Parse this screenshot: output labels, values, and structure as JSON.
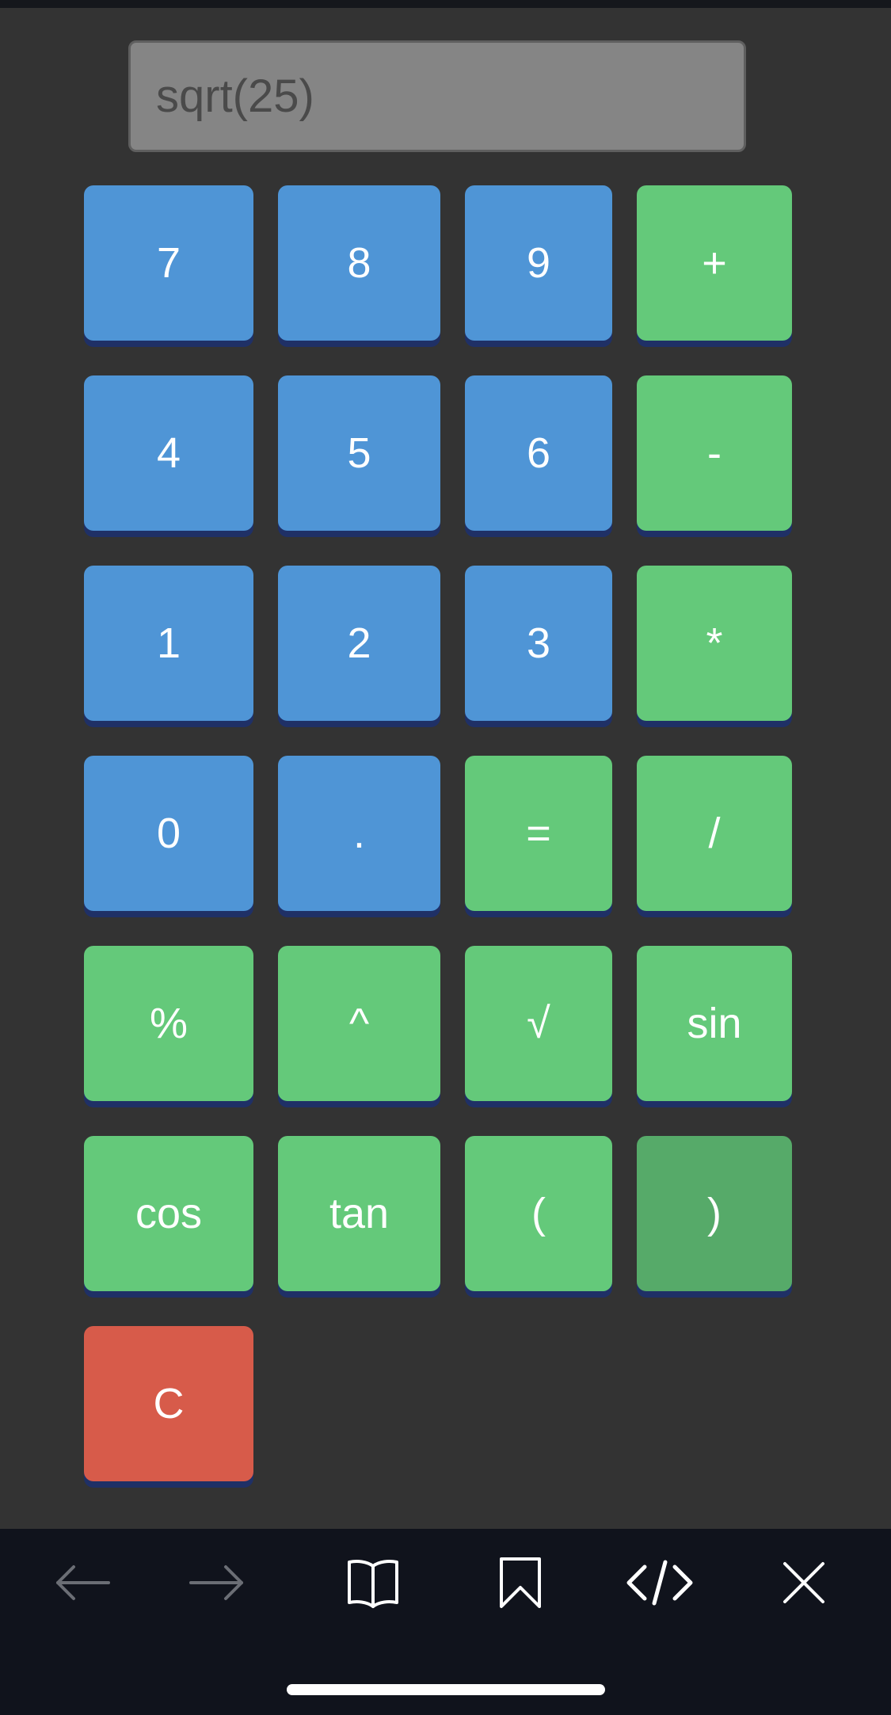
{
  "display": {
    "expression": "sqrt(25)"
  },
  "keypad": {
    "keys": [
      {
        "label": "7",
        "kind": "num"
      },
      {
        "label": "8",
        "kind": "num"
      },
      {
        "label": "9",
        "kind": "num"
      },
      {
        "label": "+",
        "kind": "op"
      },
      {
        "label": "4",
        "kind": "num"
      },
      {
        "label": "5",
        "kind": "num"
      },
      {
        "label": "6",
        "kind": "num"
      },
      {
        "label": "-",
        "kind": "op"
      },
      {
        "label": "1",
        "kind": "num"
      },
      {
        "label": "2",
        "kind": "num"
      },
      {
        "label": "3",
        "kind": "num"
      },
      {
        "label": "*",
        "kind": "op"
      },
      {
        "label": "0",
        "kind": "num"
      },
      {
        "label": ".",
        "kind": "num"
      },
      {
        "label": "=",
        "kind": "op"
      },
      {
        "label": "/",
        "kind": "op"
      },
      {
        "label": "%",
        "kind": "op"
      },
      {
        "label": "^",
        "kind": "op"
      },
      {
        "label": "√",
        "kind": "op"
      },
      {
        "label": "sin",
        "kind": "op"
      },
      {
        "label": "cos",
        "kind": "op"
      },
      {
        "label": "tan",
        "kind": "op"
      },
      {
        "label": "(",
        "kind": "op"
      },
      {
        "label": ")",
        "kind": "op",
        "state": "pressed"
      },
      {
        "label": "C",
        "kind": "clear"
      }
    ]
  },
  "colors": {
    "background": "#333333",
    "number_key": "#4f95d6",
    "operator_key": "#64c97a",
    "operator_key_pressed": "#56aa69",
    "clear_key": "#d75b4a",
    "display_bg": "#858585",
    "toolbar_bg": "#10131c"
  },
  "toolbar": {
    "items": [
      {
        "name": "back-button",
        "icon": "arrow-left-icon",
        "enabled": false
      },
      {
        "name": "forward-button",
        "icon": "arrow-right-icon",
        "enabled": false
      },
      {
        "name": "reader-button",
        "icon": "book-icon",
        "enabled": true
      },
      {
        "name": "bookmark-button",
        "icon": "bookmark-icon",
        "enabled": true
      },
      {
        "name": "source-code-button",
        "icon": "code-icon",
        "enabled": true
      },
      {
        "name": "close-button",
        "icon": "close-icon",
        "enabled": true
      }
    ]
  }
}
